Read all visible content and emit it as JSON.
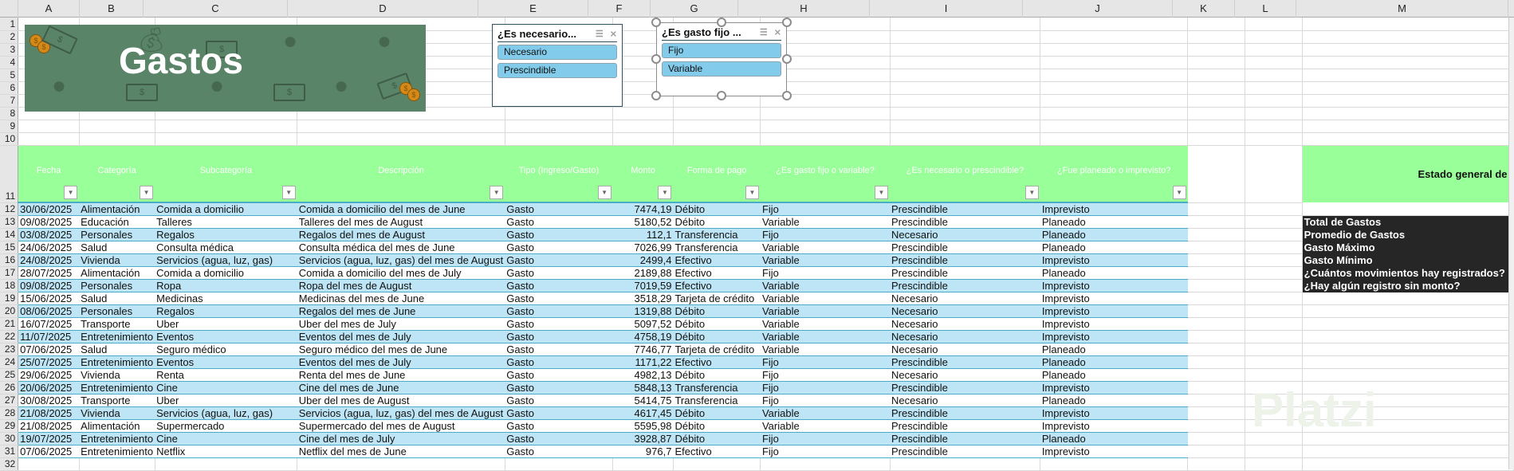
{
  "columns": [
    "A",
    "B",
    "C",
    "D",
    "E",
    "F",
    "G",
    "H",
    "I",
    "J",
    "K",
    "L",
    "M"
  ],
  "banner": {
    "title": "Gastos"
  },
  "slicers": [
    {
      "title": "¿Es necesario...",
      "items": [
        "Necesario",
        "Prescindible"
      ]
    },
    {
      "title": "¿Es gasto fijo ...",
      "items": [
        "Fijo",
        "Variable"
      ]
    }
  ],
  "table": {
    "headers": [
      "Fecha",
      "Categoría",
      "Subcategoría",
      "Descripción",
      "Tipo (Ingreso/Gasto)",
      "Monto",
      "Forma de pago",
      "¿Es gasto fijo o variable?",
      "¿Es necesario o prescindible?",
      "¿Fue planeado o imprevisto?"
    ],
    "rows": [
      [
        "30/06/2025",
        "Alimentación",
        "Comida a domicilio",
        "Comida a domicilio del mes de June",
        "Gasto",
        "7474,19",
        "Débito",
        "Fijo",
        "Prescindible",
        "Imprevisto"
      ],
      [
        "09/08/2025",
        "Educación",
        "Talleres",
        "Talleres del mes de August",
        "Gasto",
        "5180,52",
        "Débito",
        "Variable",
        "Prescindible",
        "Planeado"
      ],
      [
        "03/08/2025",
        "Personales",
        "Regalos",
        "Regalos del mes de August",
        "Gasto",
        "112,1",
        "Transferencia",
        "Fijo",
        "Necesario",
        "Planeado"
      ],
      [
        "24/06/2025",
        "Salud",
        "Consulta médica",
        "Consulta médica del mes de June",
        "Gasto",
        "7026,99",
        "Transferencia",
        "Variable",
        "Prescindible",
        "Planeado"
      ],
      [
        "24/08/2025",
        "Vivienda",
        "Servicios (agua, luz, gas)",
        "Servicios (agua, luz, gas) del mes de August",
        "Gasto",
        "2499,4",
        "Efectivo",
        "Variable",
        "Prescindible",
        "Imprevisto"
      ],
      [
        "28/07/2025",
        "Alimentación",
        "Comida a domicilio",
        "Comida a domicilio del mes de July",
        "Gasto",
        "2189,88",
        "Efectivo",
        "Fijo",
        "Prescindible",
        "Planeado"
      ],
      [
        "09/08/2025",
        "Personales",
        "Ropa",
        "Ropa del mes de August",
        "Gasto",
        "7019,59",
        "Efectivo",
        "Variable",
        "Prescindible",
        "Imprevisto"
      ],
      [
        "15/06/2025",
        "Salud",
        "Medicinas",
        "Medicinas del mes de June",
        "Gasto",
        "3518,29",
        "Tarjeta de crédito",
        "Variable",
        "Necesario",
        "Imprevisto"
      ],
      [
        "08/06/2025",
        "Personales",
        "Regalos",
        "Regalos del mes de June",
        "Gasto",
        "1319,88",
        "Débito",
        "Variable",
        "Necesario",
        "Imprevisto"
      ],
      [
        "16/07/2025",
        "Transporte",
        "Uber",
        "Uber del mes de July",
        "Gasto",
        "5097,52",
        "Débito",
        "Variable",
        "Necesario",
        "Imprevisto"
      ],
      [
        "11/07/2025",
        "Entretenimiento",
        "Eventos",
        "Eventos del mes de July",
        "Gasto",
        "4758,19",
        "Débito",
        "Variable",
        "Necesario",
        "Imprevisto"
      ],
      [
        "07/06/2025",
        "Salud",
        "Seguro médico",
        "Seguro médico del mes de June",
        "Gasto",
        "7746,77",
        "Tarjeta de crédito",
        "Variable",
        "Necesario",
        "Planeado"
      ],
      [
        "25/07/2025",
        "Entretenimiento",
        "Eventos",
        "Eventos del mes de July",
        "Gasto",
        "1171,22",
        "Efectivo",
        "Fijo",
        "Prescindible",
        "Planeado"
      ],
      [
        "29/06/2025",
        "Vivienda",
        "Renta",
        "Renta del mes de June",
        "Gasto",
        "4982,13",
        "Débito",
        "Fijo",
        "Necesario",
        "Planeado"
      ],
      [
        "20/06/2025",
        "Entretenimiento",
        "Cine",
        "Cine del mes de June",
        "Gasto",
        "5848,13",
        "Transferencia",
        "Fijo",
        "Prescindible",
        "Imprevisto"
      ],
      [
        "30/08/2025",
        "Transporte",
        "Uber",
        "Uber del mes de August",
        "Gasto",
        "5414,75",
        "Transferencia",
        "Fijo",
        "Necesario",
        "Planeado"
      ],
      [
        "21/08/2025",
        "Vivienda",
        "Servicios (agua, luz, gas)",
        "Servicios (agua, luz, gas) del mes de August",
        "Gasto",
        "4617,45",
        "Débito",
        "Variable",
        "Prescindible",
        "Imprevisto"
      ],
      [
        "21/08/2025",
        "Alimentación",
        "Supermercado",
        "Supermercado del mes de August",
        "Gasto",
        "5595,98",
        "Débito",
        "Variable",
        "Prescindible",
        "Imprevisto"
      ],
      [
        "19/07/2025",
        "Entretenimiento",
        "Cine",
        "Cine del mes de July",
        "Gasto",
        "3928,87",
        "Débito",
        "Fijo",
        "Prescindible",
        "Planeado"
      ],
      [
        "07/06/2025",
        "Entretenimiento",
        "Netflix",
        "Netflix del mes de June",
        "Gasto",
        "976,7",
        "Efectivo",
        "Fijo",
        "Prescindible",
        "Imprevisto"
      ]
    ]
  },
  "summary": {
    "header": "Estado general de",
    "labels": [
      "Total de Gastos",
      "Promedio de Gastos",
      "Gasto Máximo",
      "Gasto Mínimo",
      "¿Cuántos movimientos hay registrados?",
      "¿Hay algún registro sin monto?"
    ]
  },
  "watermark": "Platzi",
  "colors": {
    "header_green": "#99ff99",
    "band_blue": "#bde5f5",
    "banner_green": "#5a8468",
    "slicer_item": "#83cbeb"
  }
}
